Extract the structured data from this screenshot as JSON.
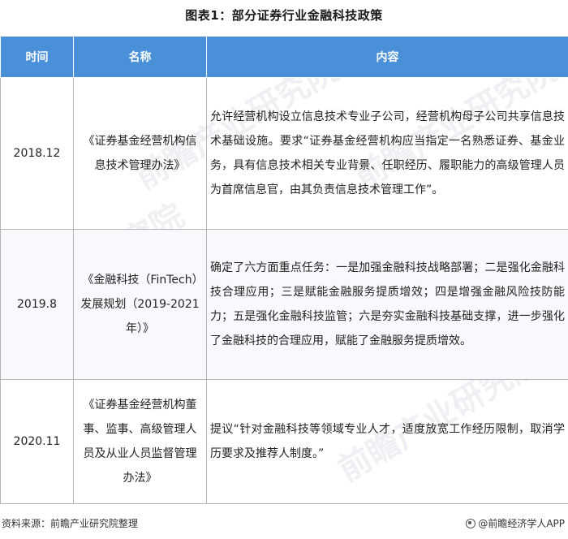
{
  "title": "图表1：部分证券行业金融科技政策",
  "table": {
    "headers": [
      "时间",
      "名称",
      "内容"
    ],
    "rows": [
      {
        "time": "2018.12",
        "name": "《证券基金经营机构信息技术管理办法》",
        "content": "允许经营机构设立信息技术专业子公司，经营机构母子公司共享信息技术基础设施。要求“证券基金经营机构应当指定一名熟悉证券、基金业务，具有信息技术相关专业背景、任职经历、履职能力的高级管理人员为首席信息官，由其负责信息技术管理工作”。"
      },
      {
        "time": "2019.8",
        "name": "《金融科技（FinTech）发展规划（2019-2021年）》",
        "content": "确定了六方面重点任务：一是加强金融科技战略部署；二是强化金融科技合理应用；三是赋能金融服务提质增效；四是增强金融风险技防能力；五是强化金融科技监管；六是夯实金融科技基础支撑，进一步强化了金融科技的合理应用，赋能了金融服务提质增效。"
      },
      {
        "time": "2020.11",
        "name": "《证券基金经营机构董事、监事、高级管理人员及从业人员监督管理办法》",
        "content": "提议“针对金融科技等领域专业人才，适度放宽工作经历限制，取消学历要求及推荐人制度。”"
      }
    ]
  },
  "footer": {
    "source": "资料来源：前瞻产业研究院整理",
    "brand": "@前瞻经济学人APP"
  },
  "watermark_text": "前瞻产业研究院",
  "colors": {
    "header_bg": "#4a90d9",
    "border": "#b5b5b5"
  }
}
